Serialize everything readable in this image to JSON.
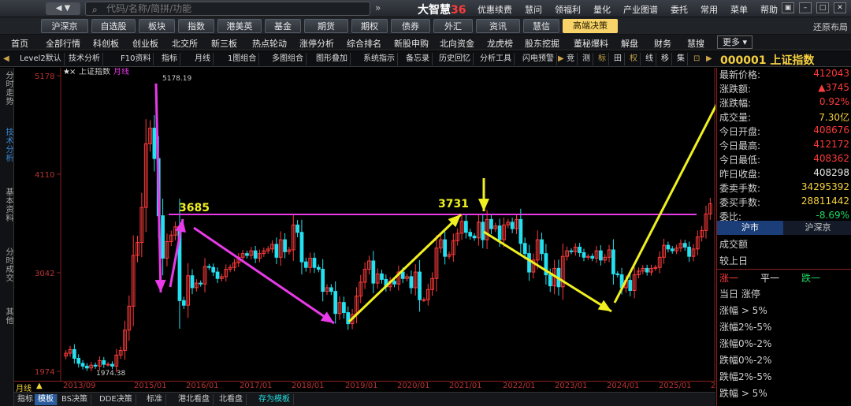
{
  "topbar": {
    "nav": "◀  ▼",
    "search_placeholder": "代码/名称/简拼/功能",
    "dbl_arrow": "»",
    "brand_name": "大智慧",
    "brand_num": "36",
    "menu": [
      "优惠续费",
      "慧问",
      "领福利",
      "量化",
      "产业图谱",
      "委托",
      "常用",
      "菜单",
      "帮助"
    ]
  },
  "toolbar2": {
    "buttons": [
      "沪深京",
      "自选股",
      "板块",
      "指数",
      "港美英",
      "基金",
      "期货",
      "期权",
      "债券",
      "外汇",
      "资讯",
      "慧信"
    ],
    "gaoduan": "高端决策",
    "restore": "还原布局"
  },
  "toolbar3": {
    "items": [
      "首页",
      "全部行情",
      "科创板",
      "创业板",
      "北交所",
      "新三板",
      "热点轮动",
      "涨停分析",
      "综合排名",
      "新股申购",
      "北向资金",
      "龙虎榜",
      "股东挖掘",
      "董秘爆料",
      "解盘",
      "财务",
      "慧搜"
    ],
    "more": "更多"
  },
  "toolbar4": {
    "items": [
      "Level2默认",
      "技术分析",
      "F10资料",
      "指标",
      "月线",
      "1图组合",
      "多图组合",
      "图形叠加",
      "系统指示",
      "备忘录",
      "历史回忆",
      "分析工具",
      "闪电预警"
    ],
    "tools": [
      "竞",
      "测",
      "标",
      "田",
      "权",
      "线",
      "移",
      "集"
    ]
  },
  "lefttabs": [
    "分时走势",
    "技术分析",
    "基本资料",
    "分时成交",
    "其他"
  ],
  "chart_data": {
    "type": "candlestick",
    "title": "上证指数",
    "period": "月线",
    "y_ticks": [
      1974,
      3042,
      4110,
      5178
    ],
    "ylim": [
      1974,
      5178
    ],
    "x_ticks": [
      "2013/09",
      "2015/01",
      "2016/01",
      "2017/01",
      "2018/01",
      "2019/01",
      "2020/01",
      "2021/01",
      "2022/01",
      "2023/01",
      "2024/01",
      "2025/01",
      "2"
    ],
    "period_label": "月线",
    "annotations": {
      "high_label": "5178.19",
      "low_label": "1974.38",
      "level_1": "3685",
      "level_2": "3731"
    },
    "series_close": [
      2170,
      2210,
      2115,
      2060,
      2030,
      2010,
      2040,
      2030,
      2090,
      2050,
      2050,
      2030,
      2150,
      2200,
      2420,
      2680,
      3230,
      3370,
      3750,
      4440,
      4610,
      4280,
      3660,
      3200,
      3380,
      3450,
      3540,
      2740,
      2690,
      3010,
      2880,
      2930,
      2920,
      3110,
      3100,
      3050,
      2980,
      3000,
      3080,
      3100,
      3150,
      3210,
      3250,
      3230,
      3280,
      3200,
      3250,
      3280,
      3300,
      3350,
      3210,
      3400,
      3270,
      3290,
      3560,
      3480,
      3160,
      3100,
      3200,
      3100,
      3080,
      2840,
      2880,
      2840,
      2600,
      2720,
      2610,
      2490,
      2590,
      2790,
      2940,
      3080,
      3170,
      2930,
      3030,
      2970,
      2890,
      2950,
      2920,
      3050,
      2980,
      3000,
      2880,
      3050,
      2750,
      2750,
      2860,
      2980,
      3310,
      3400,
      3220,
      3240,
      3390,
      3470,
      3600,
      3480,
      3440,
      3420,
      3590,
      3400,
      3620,
      3520,
      3550,
      3400,
      3560,
      3590,
      3520,
      3620,
      3360,
      3250,
      3050,
      3180,
      3400,
      3250,
      3020,
      2900,
      3090,
      2890,
      3220,
      3280,
      3270,
      3320,
      3260,
      3210,
      3220,
      3200,
      3280,
      3180,
      3210,
      3290,
      3030,
      3020,
      2880,
      2960,
      2850,
      3020,
      3060,
      3090,
      3050,
      3090,
      3100,
      3210,
      3340,
      3300,
      3280,
      3310,
      3360,
      3320,
      3220,
      3300,
      3430,
      3500,
      3680,
      3790
    ]
  },
  "rpanel": {
    "title": "000001 上证指数",
    "rows": [
      {
        "label": "最新价格:",
        "value": "412043"
      },
      {
        "label": "涨跌额:",
        "value": "▲3745"
      },
      {
        "label": "涨跌幅:",
        "value": "0.92%"
      },
      {
        "label": "成交量:",
        "value": "7.30亿"
      },
      {
        "label": "今日开盘:",
        "value": "408676"
      },
      {
        "label": "今日最高:",
        "value": "412172"
      },
      {
        "label": "今日最低:",
        "value": "408362"
      },
      {
        "label": "昨日收盘:",
        "value": "408298"
      },
      {
        "label": "委卖手数:",
        "value": "34295392"
      },
      {
        "label": "委买手数:",
        "value": "28811442"
      },
      {
        "label": "委比:",
        "value": "-8.69%"
      }
    ],
    "tabs": [
      "沪市",
      "沪深京"
    ],
    "stats": [
      "成交额",
      "较上日"
    ],
    "updown": {
      "up": "涨一",
      "flat": "平一",
      "down": "跌一"
    },
    "lists": [
      "当日 涨停",
      "涨幅 > 5%",
      "涨幅2%-5%",
      "涨幅0%-2%",
      "跌幅0%-2%",
      "跌幅2%-5%",
      "跌幅 > 5%"
    ]
  },
  "bottombar": [
    "指标",
    "模板",
    "BS决策",
    "DDE决策",
    "标准",
    "港北看盘",
    "北看盘",
    "存为模板"
  ],
  "colors": {
    "up": "#ff3b3b",
    "down": "#25e0f0",
    "magenta": "#e83ae8",
    "yellow": "#f0f020",
    "axis": "#8a2020"
  }
}
